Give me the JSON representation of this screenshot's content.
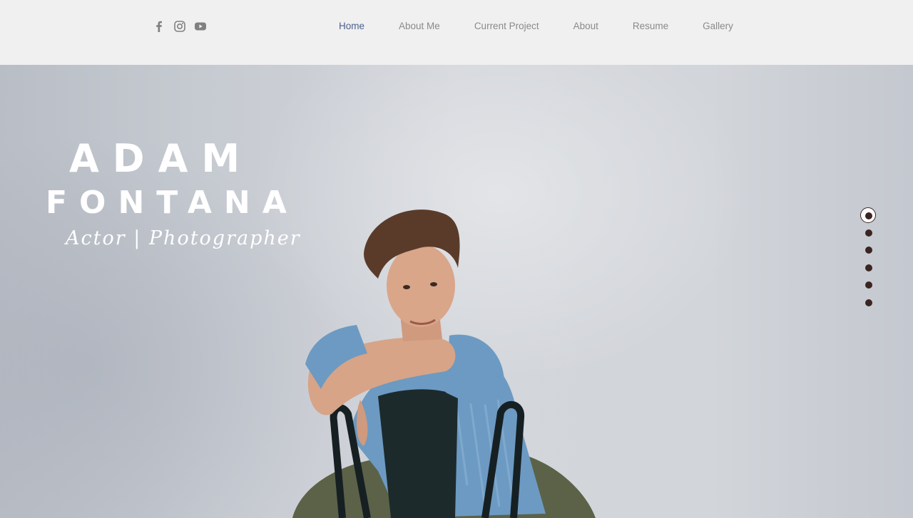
{
  "header": {
    "social": [
      {
        "name": "facebook-icon"
      },
      {
        "name": "instagram-icon"
      },
      {
        "name": "youtube-icon"
      }
    ],
    "nav": [
      {
        "label": "Home",
        "active": true
      },
      {
        "label": "About Me"
      },
      {
        "label": "Current Project"
      },
      {
        "label": "About"
      },
      {
        "label": "Resume"
      },
      {
        "label": "Gallery"
      }
    ]
  },
  "hero": {
    "first_name": "ADAM",
    "last_name": "FONTANA",
    "subtitle": "Actor | Photographer",
    "image": "man-leaning-on-chair-photo"
  },
  "anchor_menu": {
    "count": 6,
    "active_index": 0
  },
  "colors": {
    "nav_active": "#4b5f8c",
    "nav_text": "#8a8a8a",
    "header_bg": "#f0f0f0",
    "dot": "#3b2520"
  }
}
